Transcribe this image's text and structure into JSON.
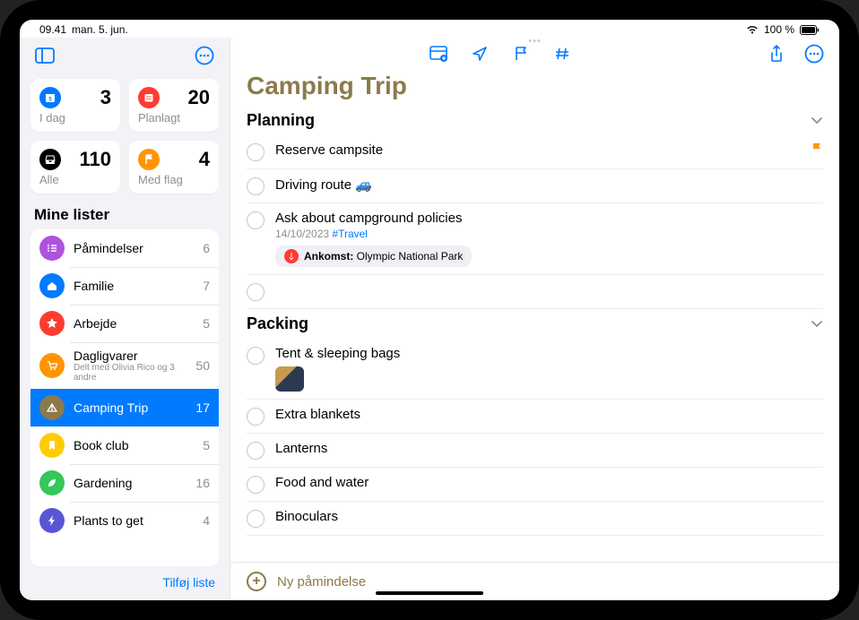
{
  "statusbar": {
    "time": "09.41",
    "date": "man. 5. jun.",
    "battery": "100 %"
  },
  "smartLists": {
    "today": {
      "label": "I dag",
      "count": "3"
    },
    "scheduled": {
      "label": "Planlagt",
      "count": "20"
    },
    "all": {
      "label": "Alle",
      "count": "110"
    },
    "flagged": {
      "label": "Med flag",
      "count": "4"
    }
  },
  "myListsTitle": "Mine lister",
  "lists": [
    {
      "name": "Påmindelser",
      "count": "6",
      "color": "#af52de",
      "icon": "list"
    },
    {
      "name": "Familie",
      "count": "7",
      "color": "#007aff",
      "icon": "house"
    },
    {
      "name": "Arbejde",
      "count": "5",
      "color": "#ff3b30",
      "icon": "star"
    },
    {
      "name": "Dagligvarer",
      "count": "50",
      "color": "#ff9500",
      "icon": "cart",
      "sub": "Delt med Olivia Rico og 3 andre"
    },
    {
      "name": "Camping Trip",
      "count": "17",
      "color": "#8c7a4a",
      "icon": "tent",
      "selected": true
    },
    {
      "name": "Book club",
      "count": "5",
      "color": "#ffcc00",
      "icon": "bookmark"
    },
    {
      "name": "Gardening",
      "count": "16",
      "color": "#34c759",
      "icon": "leaf"
    },
    {
      "name": "Plants to get",
      "count": "4",
      "color": "#5856d6",
      "icon": "bolt"
    }
  ],
  "sidebarFooter": {
    "addList": "Tilføj liste"
  },
  "main": {
    "title": "Camping Trip",
    "sections": [
      {
        "name": "Planning",
        "items": [
          {
            "title": "Reserve campsite",
            "flag": true
          },
          {
            "title": "Driving route 🚙"
          },
          {
            "title": "Ask about campground policies",
            "date": "14/10/2023",
            "tag": "#Travel",
            "location": {
              "prefix": "Ankomst:",
              "place": "Olympic National Park"
            }
          },
          {
            "title": ""
          }
        ]
      },
      {
        "name": "Packing",
        "items": [
          {
            "title": "Tent & sleeping bags",
            "hasImage": true
          },
          {
            "title": "Extra blankets"
          },
          {
            "title": "Lanterns"
          },
          {
            "title": "Food and water"
          },
          {
            "title": "Binoculars"
          }
        ]
      }
    ],
    "footer": {
      "newReminder": "Ny påmindelse"
    }
  }
}
